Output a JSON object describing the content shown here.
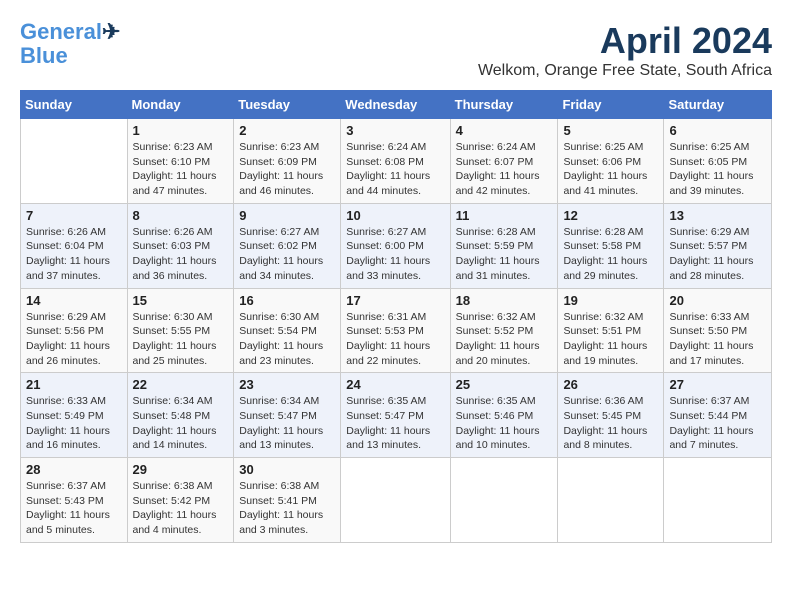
{
  "header": {
    "logo_line1": "General",
    "logo_line2": "Blue",
    "month": "April 2024",
    "location": "Welkom, Orange Free State, South Africa"
  },
  "columns": [
    "Sunday",
    "Monday",
    "Tuesday",
    "Wednesday",
    "Thursday",
    "Friday",
    "Saturday"
  ],
  "weeks": [
    [
      {
        "day": "",
        "info": ""
      },
      {
        "day": "1",
        "info": "Sunrise: 6:23 AM\nSunset: 6:10 PM\nDaylight: 11 hours\nand 47 minutes."
      },
      {
        "day": "2",
        "info": "Sunrise: 6:23 AM\nSunset: 6:09 PM\nDaylight: 11 hours\nand 46 minutes."
      },
      {
        "day": "3",
        "info": "Sunrise: 6:24 AM\nSunset: 6:08 PM\nDaylight: 11 hours\nand 44 minutes."
      },
      {
        "day": "4",
        "info": "Sunrise: 6:24 AM\nSunset: 6:07 PM\nDaylight: 11 hours\nand 42 minutes."
      },
      {
        "day": "5",
        "info": "Sunrise: 6:25 AM\nSunset: 6:06 PM\nDaylight: 11 hours\nand 41 minutes."
      },
      {
        "day": "6",
        "info": "Sunrise: 6:25 AM\nSunset: 6:05 PM\nDaylight: 11 hours\nand 39 minutes."
      }
    ],
    [
      {
        "day": "7",
        "info": "Sunrise: 6:26 AM\nSunset: 6:04 PM\nDaylight: 11 hours\nand 37 minutes."
      },
      {
        "day": "8",
        "info": "Sunrise: 6:26 AM\nSunset: 6:03 PM\nDaylight: 11 hours\nand 36 minutes."
      },
      {
        "day": "9",
        "info": "Sunrise: 6:27 AM\nSunset: 6:02 PM\nDaylight: 11 hours\nand 34 minutes."
      },
      {
        "day": "10",
        "info": "Sunrise: 6:27 AM\nSunset: 6:00 PM\nDaylight: 11 hours\nand 33 minutes."
      },
      {
        "day": "11",
        "info": "Sunrise: 6:28 AM\nSunset: 5:59 PM\nDaylight: 11 hours\nand 31 minutes."
      },
      {
        "day": "12",
        "info": "Sunrise: 6:28 AM\nSunset: 5:58 PM\nDaylight: 11 hours\nand 29 minutes."
      },
      {
        "day": "13",
        "info": "Sunrise: 6:29 AM\nSunset: 5:57 PM\nDaylight: 11 hours\nand 28 minutes."
      }
    ],
    [
      {
        "day": "14",
        "info": "Sunrise: 6:29 AM\nSunset: 5:56 PM\nDaylight: 11 hours\nand 26 minutes."
      },
      {
        "day": "15",
        "info": "Sunrise: 6:30 AM\nSunset: 5:55 PM\nDaylight: 11 hours\nand 25 minutes."
      },
      {
        "day": "16",
        "info": "Sunrise: 6:30 AM\nSunset: 5:54 PM\nDaylight: 11 hours\nand 23 minutes."
      },
      {
        "day": "17",
        "info": "Sunrise: 6:31 AM\nSunset: 5:53 PM\nDaylight: 11 hours\nand 22 minutes."
      },
      {
        "day": "18",
        "info": "Sunrise: 6:32 AM\nSunset: 5:52 PM\nDaylight: 11 hours\nand 20 minutes."
      },
      {
        "day": "19",
        "info": "Sunrise: 6:32 AM\nSunset: 5:51 PM\nDaylight: 11 hours\nand 19 minutes."
      },
      {
        "day": "20",
        "info": "Sunrise: 6:33 AM\nSunset: 5:50 PM\nDaylight: 11 hours\nand 17 minutes."
      }
    ],
    [
      {
        "day": "21",
        "info": "Sunrise: 6:33 AM\nSunset: 5:49 PM\nDaylight: 11 hours\nand 16 minutes."
      },
      {
        "day": "22",
        "info": "Sunrise: 6:34 AM\nSunset: 5:48 PM\nDaylight: 11 hours\nand 14 minutes."
      },
      {
        "day": "23",
        "info": "Sunrise: 6:34 AM\nSunset: 5:47 PM\nDaylight: 11 hours\nand 13 minutes."
      },
      {
        "day": "24",
        "info": "Sunrise: 6:35 AM\nSunset: 5:47 PM\nDaylight: 11 hours\nand 13 minutes."
      },
      {
        "day": "25",
        "info": "Sunrise: 6:35 AM\nSunset: 5:46 PM\nDaylight: 11 hours\nand 10 minutes."
      },
      {
        "day": "26",
        "info": "Sunrise: 6:36 AM\nSunset: 5:45 PM\nDaylight: 11 hours\nand 8 minutes."
      },
      {
        "day": "27",
        "info": "Sunrise: 6:37 AM\nSunset: 5:44 PM\nDaylight: 11 hours\nand 7 minutes."
      }
    ],
    [
      {
        "day": "28",
        "info": "Sunrise: 6:37 AM\nSunset: 5:43 PM\nDaylight: 11 hours\nand 5 minutes."
      },
      {
        "day": "29",
        "info": "Sunrise: 6:38 AM\nSunset: 5:42 PM\nDaylight: 11 hours\nand 4 minutes."
      },
      {
        "day": "30",
        "info": "Sunrise: 6:38 AM\nSunset: 5:41 PM\nDaylight: 11 hours\nand 3 minutes."
      },
      {
        "day": "",
        "info": ""
      },
      {
        "day": "",
        "info": ""
      },
      {
        "day": "",
        "info": ""
      },
      {
        "day": "",
        "info": ""
      }
    ]
  ]
}
